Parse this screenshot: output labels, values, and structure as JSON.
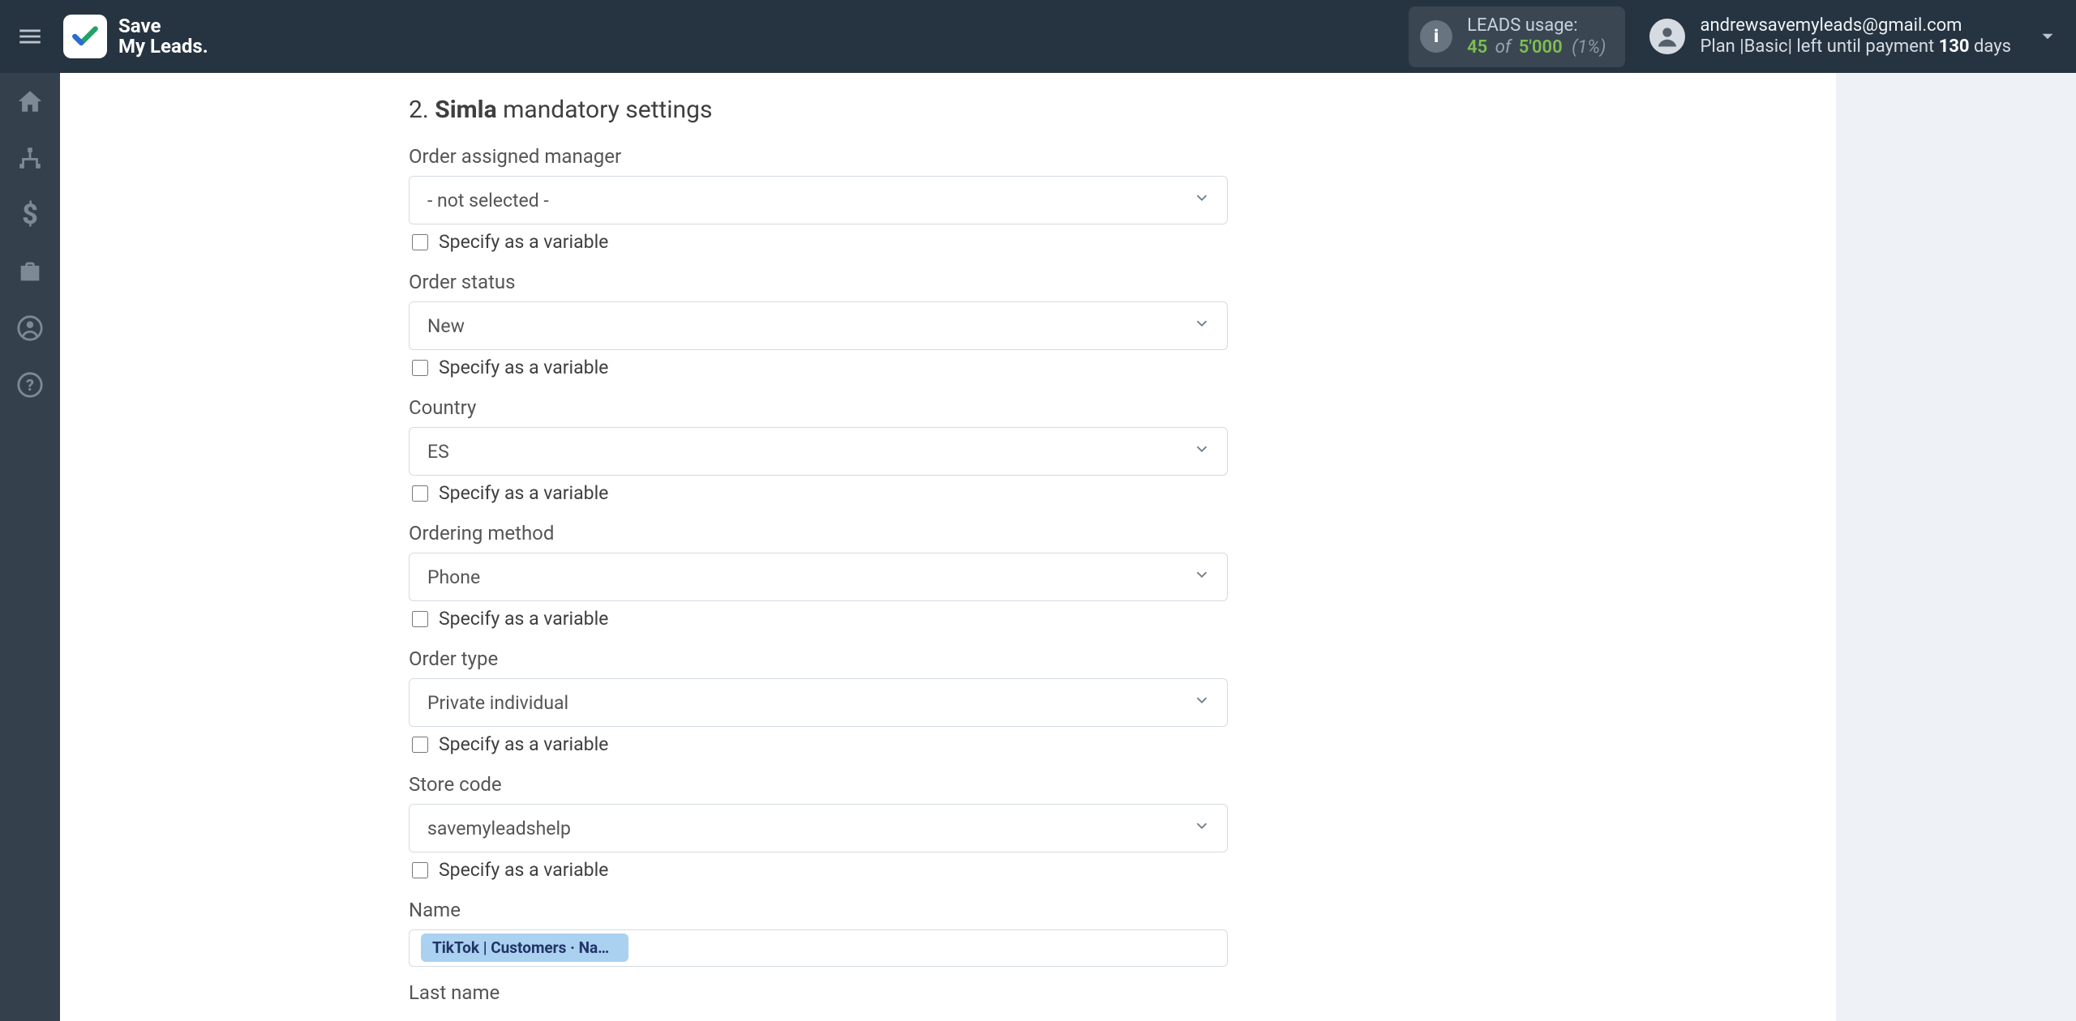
{
  "header": {
    "logo_text": "Save\nMy Leads.",
    "leads": {
      "title": "LEADS usage:",
      "used": "45",
      "of_word": "of",
      "total": "5'000",
      "percent": "(1%)"
    },
    "user": {
      "email": "andrewsavemyleads@gmail.com",
      "plan_prefix": "Plan |",
      "plan_name": "Basic",
      "plan_mid": "| left until payment ",
      "days": "130",
      "days_suffix": " days"
    }
  },
  "section": {
    "number": "2.",
    "bold": "Simla",
    "rest": " mandatory settings"
  },
  "fields": {
    "manager": {
      "label": "Order assigned manager",
      "value": "- not selected -",
      "var_label": "Specify as a variable"
    },
    "status": {
      "label": "Order status",
      "value": "New",
      "var_label": "Specify as a variable"
    },
    "country": {
      "label": "Country",
      "value": "ES",
      "var_label": "Specify as a variable"
    },
    "method": {
      "label": "Ordering method",
      "value": "Phone",
      "var_label": "Specify as a variable"
    },
    "type": {
      "label": "Order type",
      "value": "Private individual",
      "var_label": "Specify as a variable"
    },
    "store": {
      "label": "Store code",
      "value": "savemyleadshelp",
      "var_label": "Specify as a variable"
    },
    "name": {
      "label": "Name",
      "chip": "TikTok | Customers · Na…"
    },
    "lastname": {
      "label": "Last name"
    }
  }
}
